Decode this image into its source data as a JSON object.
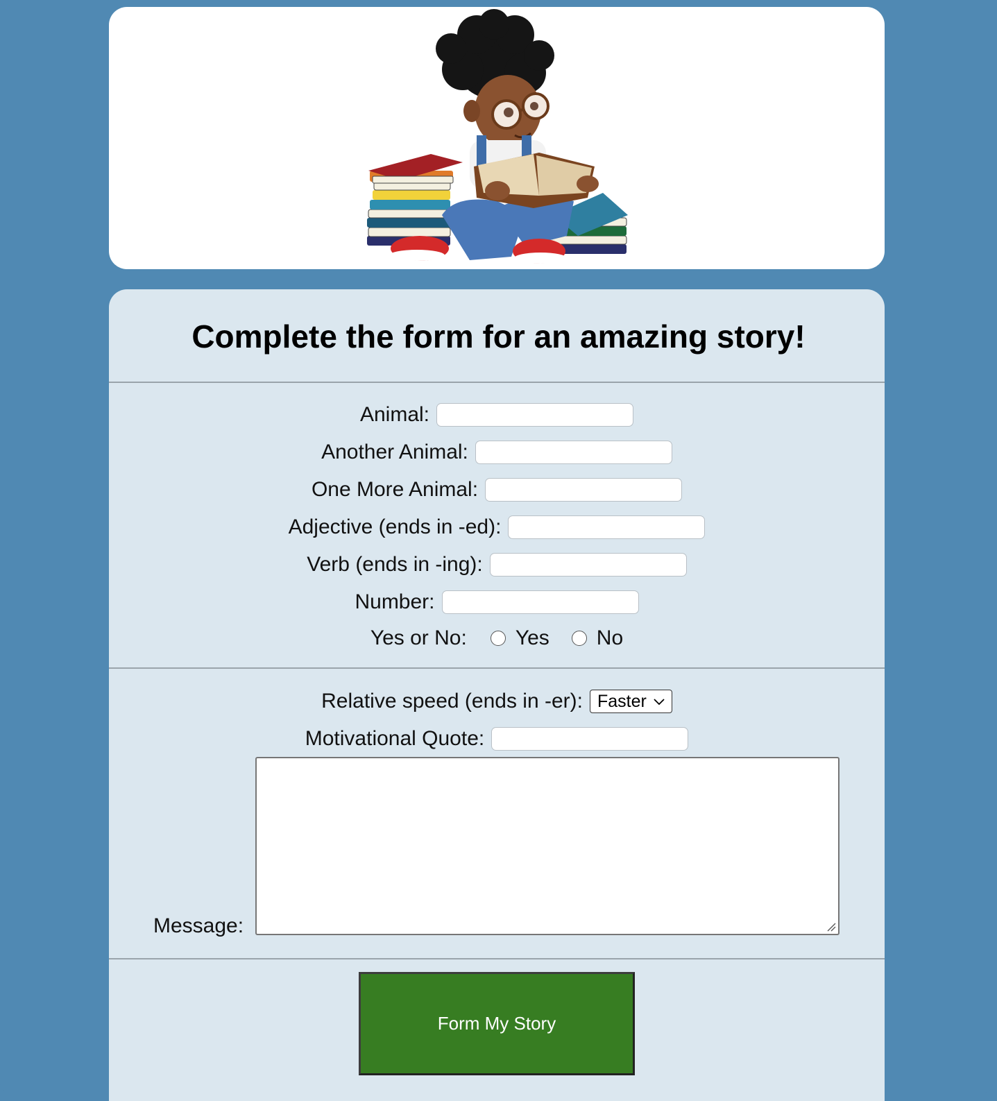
{
  "form": {
    "title": "Complete the form for an amazing story!",
    "fields": {
      "animal": {
        "label": "Animal:",
        "value": ""
      },
      "another_animal": {
        "label": "Another Animal:",
        "value": ""
      },
      "one_more_animal": {
        "label": "One More Animal:",
        "value": ""
      },
      "adjective": {
        "label": "Adjective (ends in -ed):",
        "value": ""
      },
      "verb": {
        "label": "Verb (ends in -ing):",
        "value": ""
      },
      "number": {
        "label": "Number:",
        "value": ""
      },
      "yes_no": {
        "label": "Yes or No:",
        "option_yes": "Yes",
        "option_no": "No"
      },
      "relative_speed": {
        "label": "Relative speed (ends in -er):",
        "selected": "Faster"
      },
      "motivational_quote": {
        "label": "Motivational Quote:",
        "value": ""
      },
      "message": {
        "label": "Message:",
        "value": ""
      }
    },
    "submit_label": "Form My Story"
  },
  "colors": {
    "background": "#5089b3",
    "form_panel": "#dbe7ef",
    "submit_button": "#377d22"
  },
  "icons": [
    "reading-child-illustration",
    "chevron-down-icon",
    "resize-handle-icon"
  ]
}
